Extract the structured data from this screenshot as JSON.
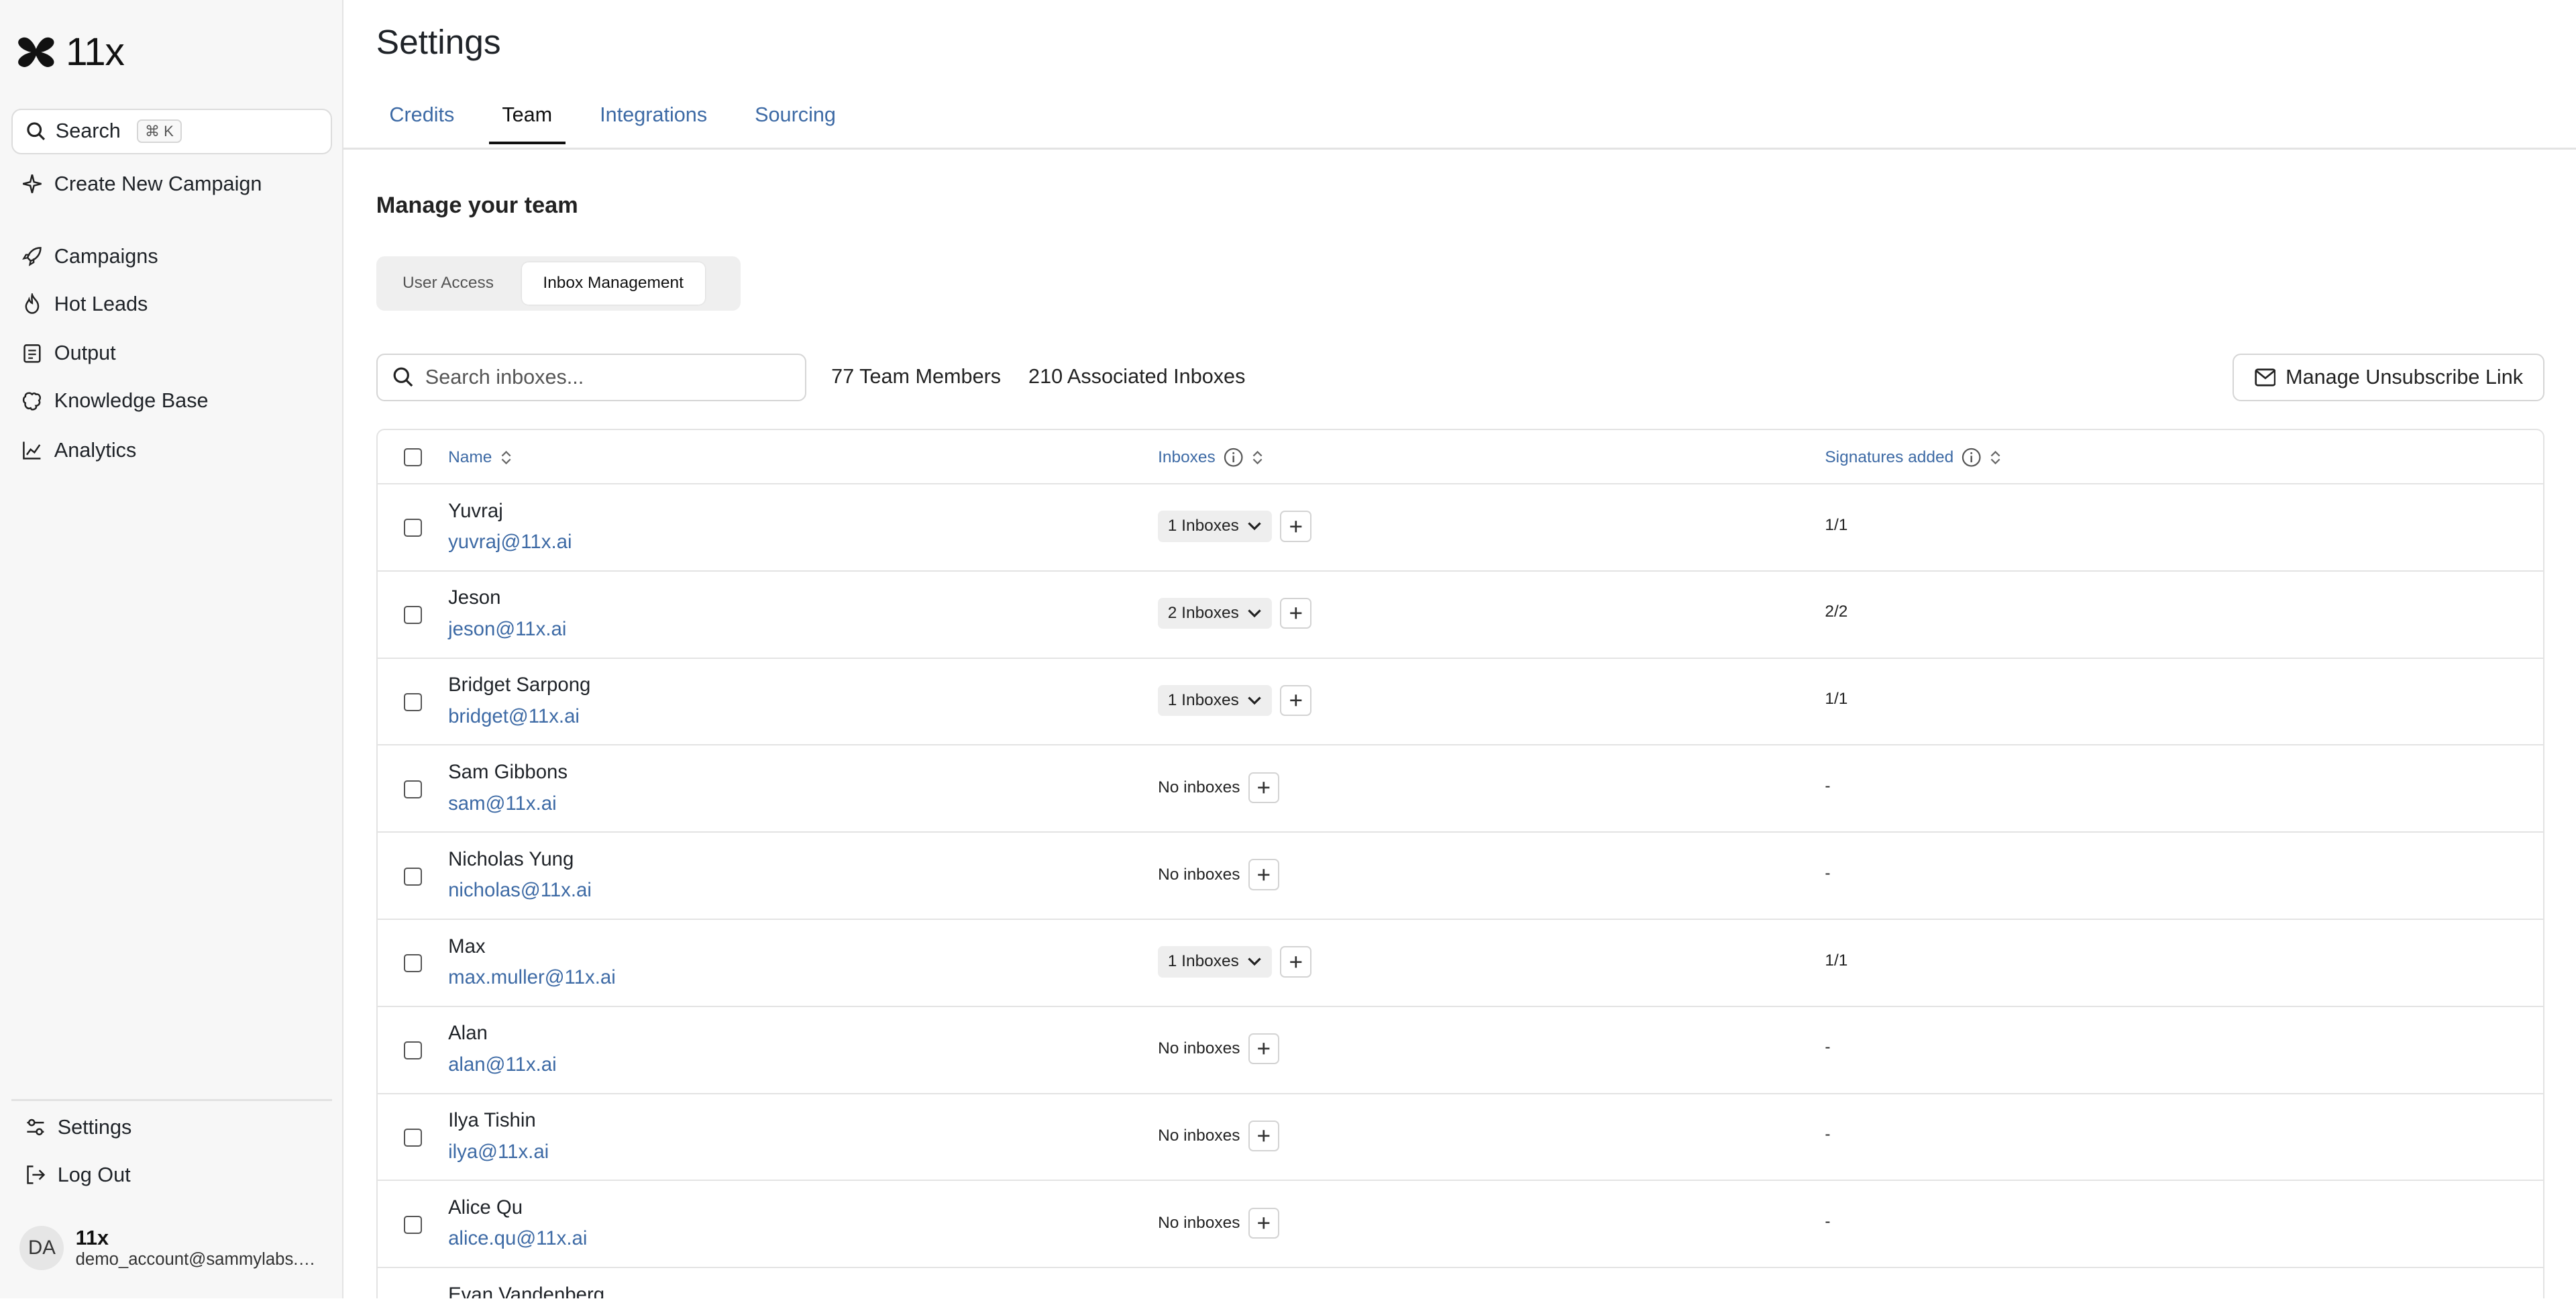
{
  "app": {
    "name": "11x"
  },
  "sidebar": {
    "search_label": "Search",
    "search_shortcut": "⌘ K",
    "create_label": "Create New Campaign",
    "items": [
      {
        "label": "Campaigns",
        "icon": "rocket-icon"
      },
      {
        "label": "Hot Leads",
        "icon": "flame-icon"
      },
      {
        "label": "Output",
        "icon": "document-icon"
      },
      {
        "label": "Knowledge Base",
        "icon": "brain-icon"
      },
      {
        "label": "Analytics",
        "icon": "chart-line-icon"
      }
    ],
    "bottom_items": [
      {
        "label": "Settings",
        "icon": "sliders-icon"
      },
      {
        "label": "Log Out",
        "icon": "logout-icon"
      }
    ],
    "user": {
      "initials": "DA",
      "name": "11x",
      "email": "demo_account@sammylabs.com"
    }
  },
  "page": {
    "title": "Settings",
    "tabs": [
      "Credits",
      "Team",
      "Integrations",
      "Sourcing"
    ],
    "active_tab": "Team",
    "section_title": "Manage your team",
    "segments": [
      "User Access",
      "Inbox Management"
    ],
    "active_segment": "Inbox Management",
    "search_placeholder": "Search inboxes...",
    "team_members": "77 Team Members",
    "associated_inboxes": "210 Associated Inboxes",
    "unsubscribe_label": "Manage Unsubscribe Link"
  },
  "table": {
    "columns": [
      "Name",
      "Inboxes",
      "Signatures added"
    ],
    "rows": [
      {
        "name": "Yuvraj",
        "email": "yuvraj@11x.ai",
        "inboxes": "1 Inboxes",
        "has_inboxes": true,
        "signatures": "1/1"
      },
      {
        "name": "Jeson",
        "email": "jeson@11x.ai",
        "inboxes": "2 Inboxes",
        "has_inboxes": true,
        "signatures": "2/2"
      },
      {
        "name": "Bridget Sarpong",
        "email": "bridget@11x.ai",
        "inboxes": "1 Inboxes",
        "has_inboxes": true,
        "signatures": "1/1"
      },
      {
        "name": "Sam Gibbons",
        "email": "sam@11x.ai",
        "inboxes": "No inboxes",
        "has_inboxes": false,
        "signatures": "-"
      },
      {
        "name": "Nicholas Yung",
        "email": "nicholas@11x.ai",
        "inboxes": "No inboxes",
        "has_inboxes": false,
        "signatures": "-"
      },
      {
        "name": "Max",
        "email": "max.muller@11x.ai",
        "inboxes": "1 Inboxes",
        "has_inboxes": true,
        "signatures": "1/1"
      },
      {
        "name": "Alan",
        "email": "alan@11x.ai",
        "inboxes": "No inboxes",
        "has_inboxes": false,
        "signatures": "-"
      },
      {
        "name": "Ilya Tishin",
        "email": "ilya@11x.ai",
        "inboxes": "No inboxes",
        "has_inboxes": false,
        "signatures": "-"
      },
      {
        "name": "Alice Qu",
        "email": "alice.qu@11x.ai",
        "inboxes": "No inboxes",
        "has_inboxes": false,
        "signatures": "-"
      },
      {
        "name": "Evan Vandenberg",
        "email": "",
        "inboxes": "",
        "has_inboxes": false,
        "signatures": ""
      }
    ]
  }
}
